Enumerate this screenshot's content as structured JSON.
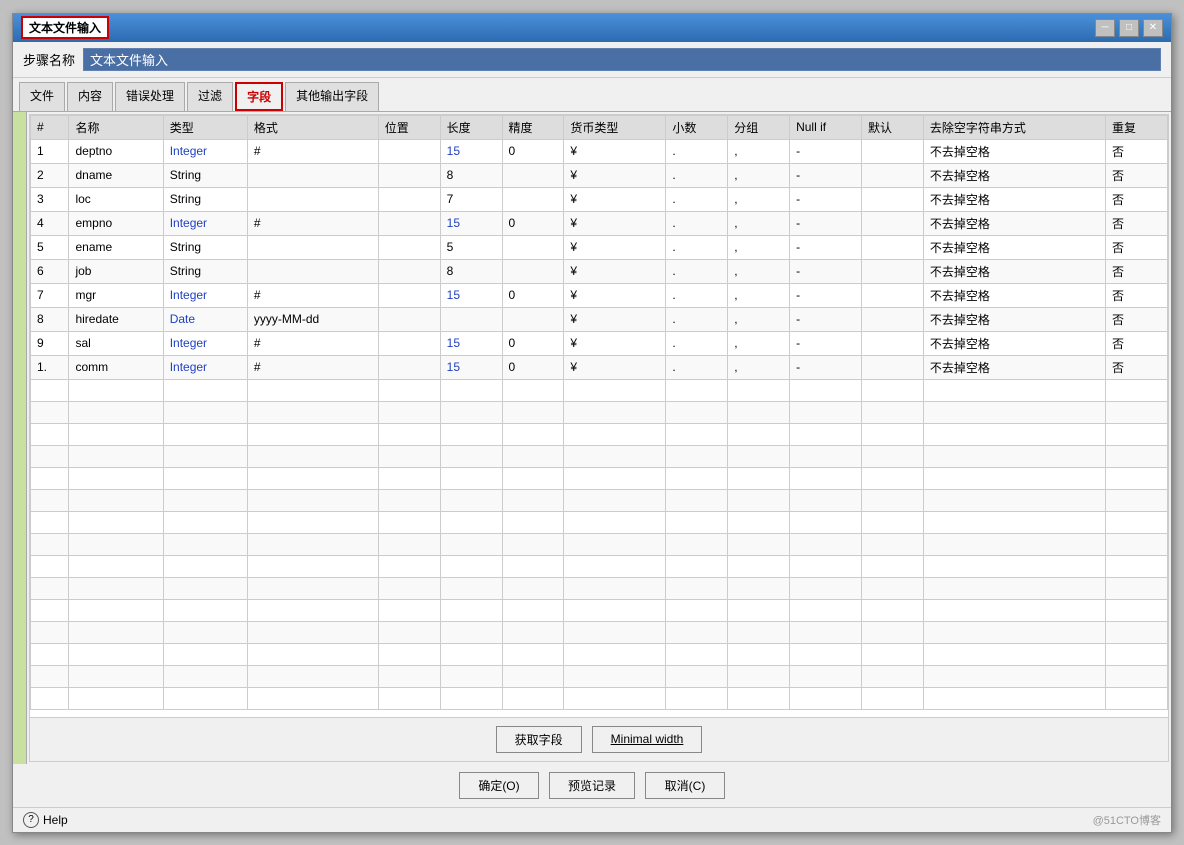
{
  "window": {
    "title": "文本文件输入",
    "controls": {
      "minimize": "─",
      "maximize": "□",
      "close": "✕"
    }
  },
  "step_name": {
    "label": "步骤名称",
    "value": "文本文件输入"
  },
  "tabs": [
    {
      "id": "file",
      "label": "文件"
    },
    {
      "id": "content",
      "label": "内容"
    },
    {
      "id": "error",
      "label": "错误处理"
    },
    {
      "id": "filter",
      "label": "过滤"
    },
    {
      "id": "fields",
      "label": "字段",
      "active": true
    },
    {
      "id": "other",
      "label": "其他输出字段"
    }
  ],
  "table": {
    "headers": [
      "#",
      "名称",
      "类型",
      "格式",
      "位置",
      "长度",
      "精度",
      "货币类型",
      "小数",
      "分组",
      "Null if",
      "默认",
      "去除空字符串方式",
      "重复"
    ],
    "rows": [
      {
        "num": "1",
        "name": "deptno",
        "type": "Integer",
        "format": "#",
        "pos": "",
        "len": "15",
        "prec": "0",
        "currency": "¥",
        "decimal": ".",
        "group": ",",
        "nullif": "-",
        "default": "",
        "trim": "不去掉空格",
        "repeat": "否"
      },
      {
        "num": "2",
        "name": "dname",
        "type": "String",
        "format": "",
        "pos": "",
        "len": "8",
        "prec": "",
        "currency": "¥",
        "decimal": ".",
        "group": ",",
        "nullif": "-",
        "default": "",
        "trim": "不去掉空格",
        "repeat": "否"
      },
      {
        "num": "3",
        "name": "loc",
        "type": "String",
        "format": "",
        "pos": "",
        "len": "7",
        "prec": "",
        "currency": "¥",
        "decimal": ".",
        "group": ",",
        "nullif": "-",
        "default": "",
        "trim": "不去掉空格",
        "repeat": "否"
      },
      {
        "num": "4",
        "name": "empno",
        "type": "Integer",
        "format": "#",
        "pos": "",
        "len": "15",
        "prec": "0",
        "currency": "¥",
        "decimal": ".",
        "group": ",",
        "nullif": "-",
        "default": "",
        "trim": "不去掉空格",
        "repeat": "否"
      },
      {
        "num": "5",
        "name": "ename",
        "type": "String",
        "format": "",
        "pos": "",
        "len": "5",
        "prec": "",
        "currency": "¥",
        "decimal": ".",
        "group": ",",
        "nullif": "-",
        "default": "",
        "trim": "不去掉空格",
        "repeat": "否"
      },
      {
        "num": "6",
        "name": "job",
        "type": "String",
        "format": "",
        "pos": "",
        "len": "8",
        "prec": "",
        "currency": "¥",
        "decimal": ".",
        "group": ",",
        "nullif": "-",
        "default": "",
        "trim": "不去掉空格",
        "repeat": "否"
      },
      {
        "num": "7",
        "name": "mgr",
        "type": "Integer",
        "format": "#",
        "pos": "",
        "len": "15",
        "prec": "0",
        "currency": "¥",
        "decimal": ".",
        "group": ",",
        "nullif": "-",
        "default": "",
        "trim": "不去掉空格",
        "repeat": "否"
      },
      {
        "num": "8",
        "name": "hiredate",
        "type": "Date",
        "format": "yyyy-MM-dd",
        "pos": "",
        "len": "",
        "prec": "",
        "currency": "¥",
        "decimal": ".",
        "group": ",",
        "nullif": "-",
        "default": "",
        "trim": "不去掉空格",
        "repeat": "否"
      },
      {
        "num": "9",
        "name": "sal",
        "type": "Integer",
        "format": "#",
        "pos": "",
        "len": "15",
        "prec": "0",
        "currency": "¥",
        "decimal": ".",
        "group": ",",
        "nullif": "-",
        "default": "",
        "trim": "不去掉空格",
        "repeat": "否"
      },
      {
        "num": "1.",
        "name": "comm",
        "type": "Integer",
        "format": "#",
        "pos": "",
        "len": "15",
        "prec": "0",
        "currency": "¥",
        "decimal": ".",
        "group": ",",
        "nullif": "-",
        "default": "",
        "trim": "不去掉空格",
        "repeat": "否"
      }
    ]
  },
  "buttons": {
    "get_fields": "获取字段",
    "minimal_width": "Minimal width",
    "ok": "确定(O)",
    "preview": "预览记录",
    "cancel": "取消(C)",
    "help": "Help"
  },
  "watermark": "@51CTO博客"
}
